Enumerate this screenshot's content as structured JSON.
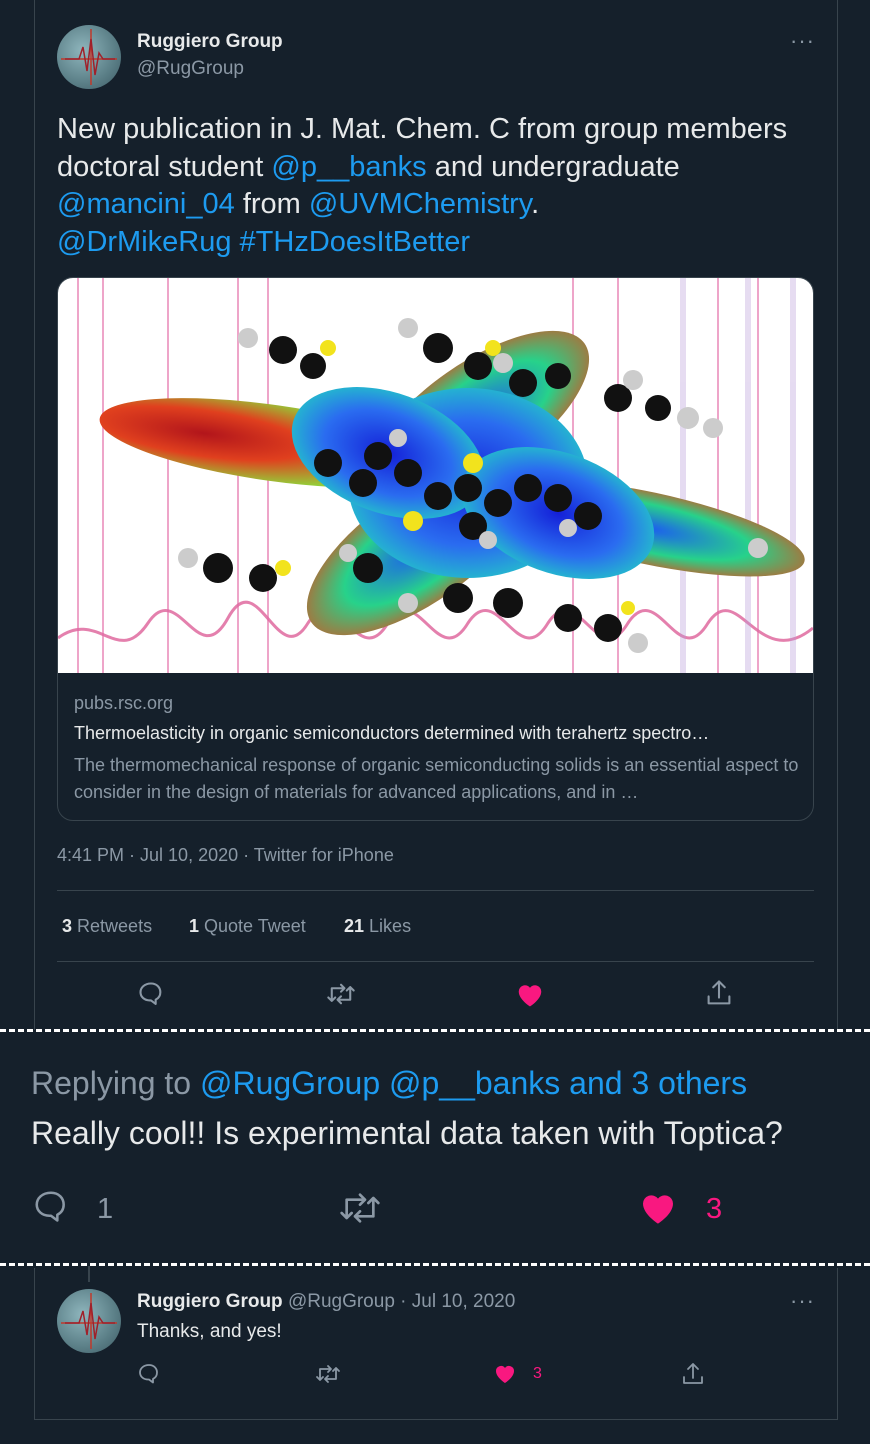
{
  "tweet": {
    "author_name": "Ruggiero Group",
    "author_handle": "@RugGroup",
    "more": "···",
    "text": {
      "p1": "New publication in J. Mat. Chem. C  from group members doctoral student ",
      "m1": "@p__banks",
      "p2": " and undergraduate ",
      "m2": "@mancini_04",
      "p3": " from ",
      "m3": "@UVMChemistry",
      "p4": ".",
      "m4": "@DrMikeRug",
      "sp": " ",
      "h1": "#THzDoesItBetter"
    },
    "card": {
      "domain": "pubs.rsc.org",
      "title": "Thermoelasticity in organic semiconductors determined with terahertz spectro…",
      "description": "The thermomechanical response of organic semiconducting solids is an essential aspect to consider in the design of materials for advanced applications, and in …"
    },
    "timestamp": "4:41 PM · Jul 10, 2020 · Twitter for iPhone",
    "stats": {
      "retweets_count": "3",
      "retweets_label": "Retweets",
      "quotes_count": "1",
      "quotes_label": "Quote Tweet",
      "likes_count": "21",
      "likes_label": "Likes"
    }
  },
  "reply1": {
    "replying_to_prefix": "Replying to ",
    "replying_to_targets": "@RugGroup @p__banks and 3 others",
    "text": "Really cool!! Is experimental data taken with Toptica?",
    "reply_count": "1",
    "like_count": "3"
  },
  "reply2": {
    "author_name": "Ruggiero Group",
    "meta": "@RugGroup · Jul 10, 2020",
    "more": "···",
    "text": "Thanks, and yes!",
    "like_count": "3"
  },
  "colors": {
    "like": "#f91880",
    "link": "#1d9bf0",
    "background": "#15202b"
  }
}
